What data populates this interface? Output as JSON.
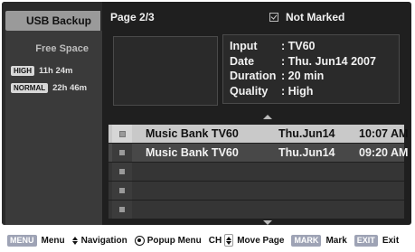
{
  "sidebar": {
    "title": "USB Backup",
    "free_space_label": "Free Space",
    "modes": [
      {
        "badge": "HIGH",
        "value": "11h 24m"
      },
      {
        "badge": "NORMAL",
        "value": "22h 46m"
      }
    ]
  },
  "header": {
    "page": "Page 2/3",
    "filter": "Not Marked"
  },
  "info": {
    "rows": [
      {
        "key": "Input",
        "value": ": TV60"
      },
      {
        "key": "Date",
        "value": ": Thu. Jun14 2007"
      },
      {
        "key": "Duration",
        "value": ": 20 min"
      },
      {
        "key": "Quality",
        "value": ": High"
      }
    ]
  },
  "list": {
    "rows": [
      {
        "title": "Music Bank  TV60",
        "date": "Thu.Jun14",
        "time": "10:07 AM"
      },
      {
        "title": "Music Bank  TV60",
        "date": "Thu.Jun14",
        "time": "09:20 AM"
      },
      {
        "title": "",
        "date": "",
        "time": ""
      },
      {
        "title": "",
        "date": "",
        "time": ""
      },
      {
        "title": "",
        "date": "",
        "time": ""
      }
    ]
  },
  "legend": {
    "menu_badge": "MENU",
    "menu_label": "Menu",
    "navigation_label": "Navigation",
    "popup_label": "Popup Menu",
    "ch_label": "CH",
    "move_page_label": "Move Page",
    "mark_badge": "MARK",
    "mark_label": "Mark",
    "exit_badge": "EXIT",
    "exit_label": "Exit"
  },
  "icons": [
    "checkbox-icon",
    "scroll-up-icon",
    "scroll-down-icon",
    "navigation-arrows-icon",
    "ok-circle-icon",
    "channel-updown-icon"
  ],
  "colors": {
    "screen_bg": "#1f1f1f",
    "highlight_row": "#c9c9c9",
    "legend_badge": "#9ea3b5"
  }
}
